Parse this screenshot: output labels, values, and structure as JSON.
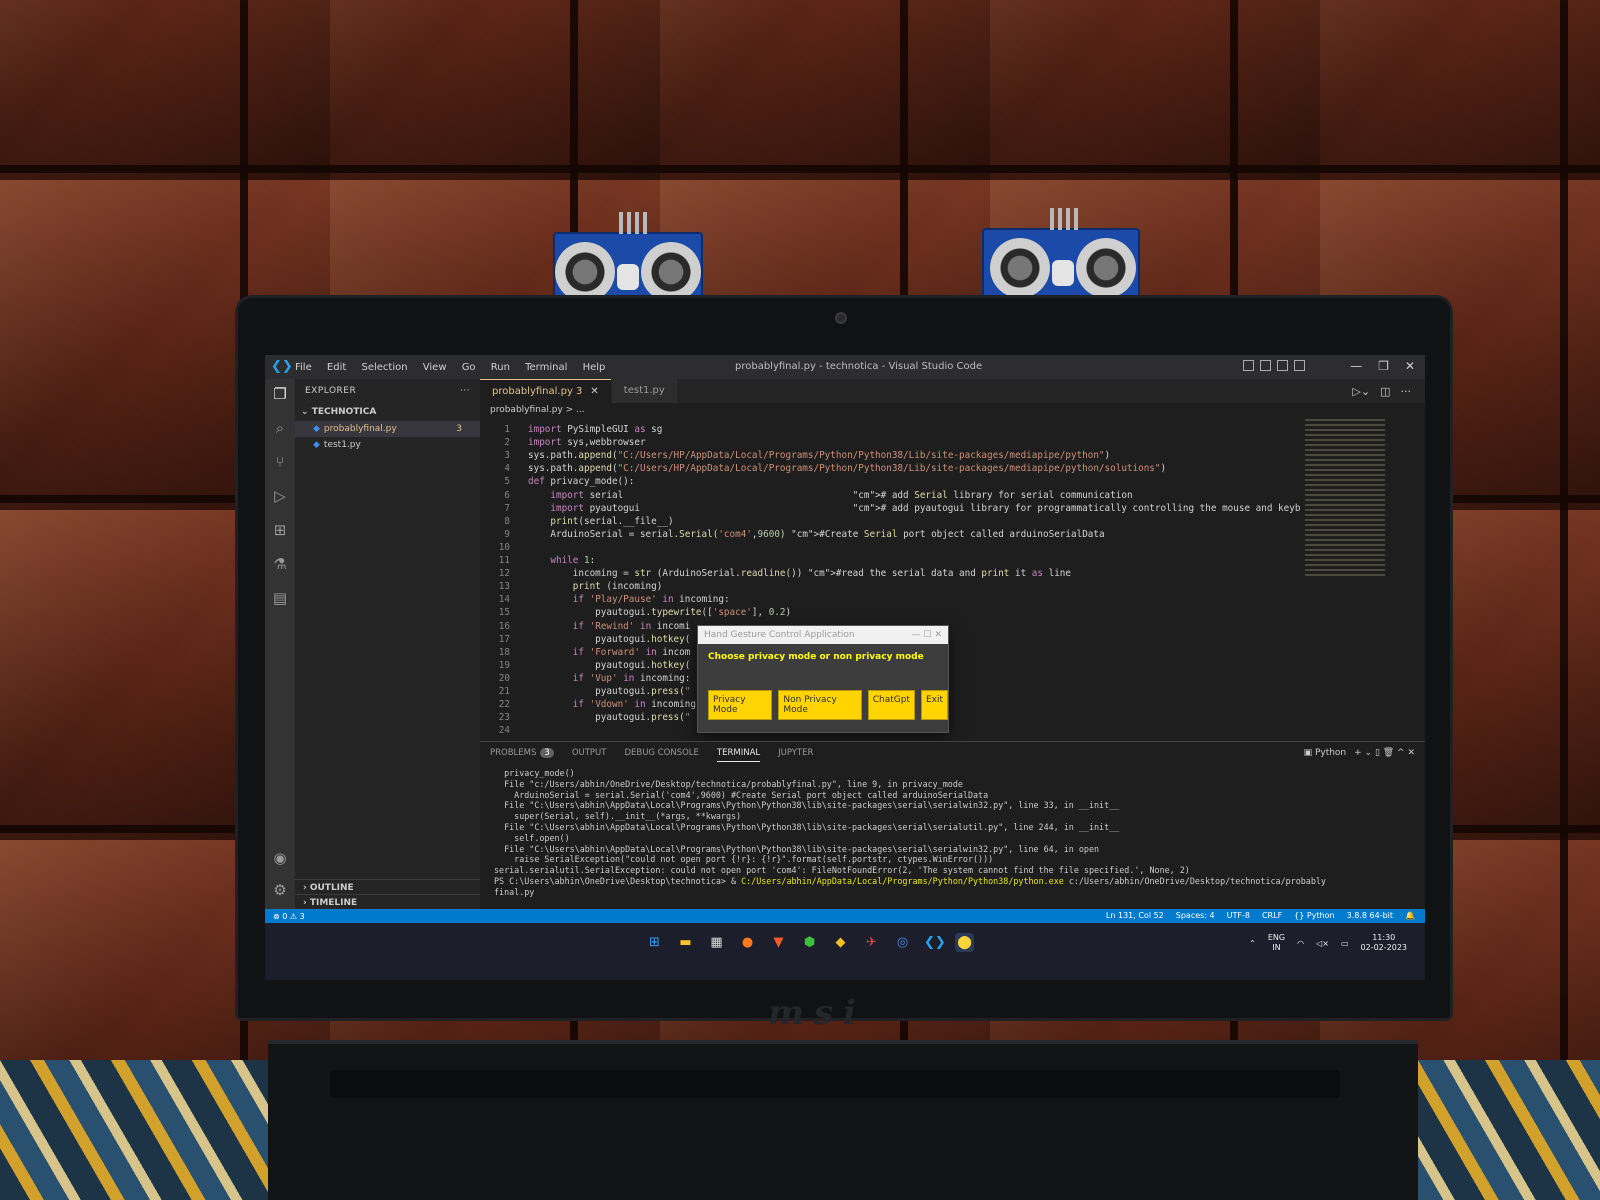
{
  "scene": {
    "laptop_brand": "msi"
  },
  "window": {
    "menu": [
      "File",
      "Edit",
      "Selection",
      "View",
      "Go",
      "Run",
      "Terminal",
      "Help"
    ],
    "title": "probablyfinal.py - technotica - Visual Studio Code",
    "controls": {
      "minimize": "—",
      "restore": "❐",
      "close": "✕"
    }
  },
  "sidebar": {
    "header": "EXPLORER",
    "more": "···",
    "folder": "TECHNOTICA",
    "files": [
      {
        "name": "probablyfinal.py",
        "badge": "3"
      },
      {
        "name": "test1.py",
        "badge": ""
      }
    ],
    "outline": "OUTLINE",
    "timeline": "TIMELINE"
  },
  "tabs": [
    {
      "label": "probablyfinal.py 3",
      "close": "✕"
    },
    {
      "label": "test1.py"
    }
  ],
  "breadcrumb": "probablyfinal.py > ...",
  "editor": {
    "lines": [
      "import PySimpleGUI as sg",
      "import sys,webbrowser",
      "sys.path.append(\"C:/Users/HP/AppData/Local/Programs/Python/Python38/Lib/site-packages/mediapipe/python\")",
      "sys.path.append(\"C:/Users/HP/AppData/Local/Programs/Python/Python38/Lib/site-packages/mediapipe/python/solutions\")",
      "def privacy_mode():",
      "    import serial                                         # add Serial library for serial communication",
      "    import pyautogui                                      # add pyautogui library for programmatically controlling the mouse and keyboard.",
      "    print(serial.__file__)",
      "    ArduinoSerial = serial.Serial('com4',9600) #Create Serial port object called arduinoSerialData",
      "",
      "    while 1:",
      "        incoming = str (ArduinoSerial.readline()) #read the serial data and print it as line",
      "        print (incoming)",
      "        if 'Play/Pause' in incoming:",
      "            pyautogui.typewrite(['space'], 0.2)",
      "        if 'Rewind' in incomi",
      "            pyautogui.hotkey(",
      "        if 'Forward' in incom",
      "            pyautogui.hotkey(",
      "        if 'Vup' in incoming:",
      "            pyautogui.press(\"",
      "        if 'Vdown' in incoming",
      "            pyautogui.press(\"",
      ""
    ]
  },
  "dialog": {
    "title": "Hand Gesture Control Application",
    "title_controls": "—   ☐   ✕",
    "message": "Choose privacy mode or non privacy mode",
    "buttons": [
      "Privacy Mode",
      "Non Privacy Mode",
      "ChatGpt",
      "Exit"
    ]
  },
  "panel": {
    "tabs": [
      "PROBLEMS",
      "OUTPUT",
      "DEBUG CONSOLE",
      "TERMINAL",
      "JUPYTER"
    ],
    "problems_count": "3",
    "shell": "Python",
    "actions": "+ ⌄  ▯  🗑  ^  ✕",
    "terminal_lines": [
      "  privacy_mode()",
      "  File \"c:/Users/abhin/OneDrive/Desktop/technotica/probablyfinal.py\", line 9, in privacy_mode",
      "    ArduinoSerial = serial.Serial('com4',9600) #Create Serial port object called arduinoSerialData",
      "  File \"C:\\Users\\abhin\\AppData\\Local\\Programs\\Python\\Python38\\lib\\site-packages\\serial\\serialwin32.py\", line 33, in __init__",
      "    super(Serial, self).__init__(*args, **kwargs)",
      "  File \"C:\\Users\\abhin\\AppData\\Local\\Programs\\Python\\Python38\\lib\\site-packages\\serial\\serialutil.py\", line 244, in __init__",
      "    self.open()",
      "  File \"C:\\Users\\abhin\\AppData\\Local\\Programs\\Python\\Python38\\lib\\site-packages\\serial\\serialwin32.py\", line 64, in open",
      "    raise SerialException(\"could not open port {!r}: {!r}\".format(self.portstr, ctypes.WinError()))",
      "serial.serialutil.SerialException: could not open port 'com4': FileNotFoundError(2, 'The system cannot find the file specified.', None, 2)"
    ],
    "prompt": "PS C:\\Users\\abhin\\OneDrive\\Desktop\\technotica> & ",
    "python_path": "C:/Users/abhin/AppData/Local/Programs/Python/Python38/python.exe",
    "script_arg": " c:/Users/abhin/OneDrive/Desktop/technotica/probably",
    "script_arg_cont": "final.py"
  },
  "statusbar": {
    "left": "⊗ 0 ⚠ 3",
    "items": [
      "Ln 131, Col 52",
      "Spaces: 4",
      "UTF-8",
      "CRLF",
      "{} Python",
      "3.8.8 64-bit"
    ]
  },
  "taskbar": {
    "lang_1": "ENG",
    "lang_2": "IN",
    "time": "11:30",
    "date": "02-02-2023"
  },
  "colors": {
    "accent": "#007acc",
    "dialog_button": "#ffd400",
    "dialog_message": "#ffff00"
  }
}
